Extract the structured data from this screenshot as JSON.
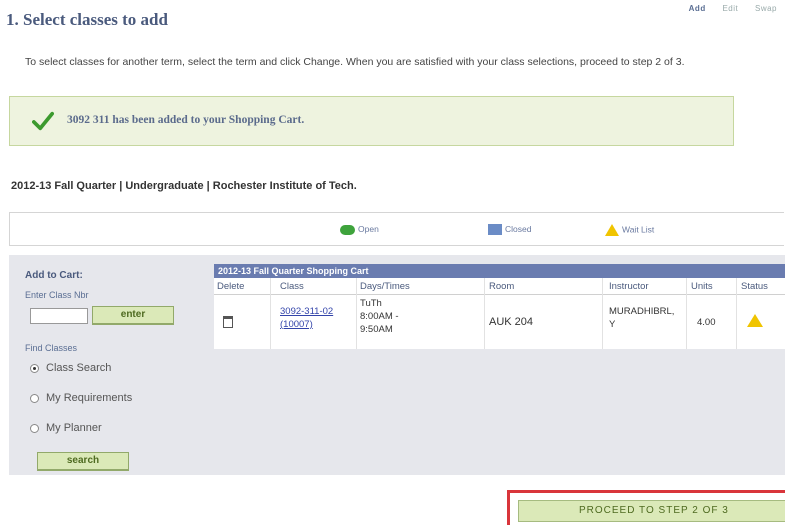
{
  "steps": [
    "Add",
    "Edit",
    "Swap"
  ],
  "page_title": "1.  Select classes to add",
  "instructions": "To select classes for another term, select the term and click Change.  When you are satisfied with your class selections, proceed to step 2 of 3.",
  "message": "3092 311 has been added to your Shopping Cart.",
  "term": "2012-13 Fall Quarter | Undergraduate | Rochester Institute of Tech.",
  "legend": {
    "open": "Open",
    "closed": "Closed",
    "wait": "Wait List"
  },
  "left": {
    "add_to_cart": "Add to Cart:",
    "enter_class_nbr": "Enter Class Nbr",
    "enter_button": "enter",
    "find_classes": "Find Classes",
    "options": [
      "Class Search",
      "My Requirements",
      "My Planner"
    ],
    "search_button": "search"
  },
  "cart": {
    "header": "2012-13 Fall Quarter Shopping Cart",
    "columns": [
      "Delete",
      "Class",
      "Days/Times",
      "Room",
      "Instructor",
      "Units",
      "Status"
    ],
    "row": {
      "class_l1": "3092-311-02",
      "class_l2": "(10007)",
      "time_l1": "TuTh",
      "time_l2": "8:00AM -",
      "time_l3": "9:50AM",
      "room": "AUK 204",
      "instructor_l1": "MURADHIBRL,",
      "instructor_l2": "Y",
      "units": "4.00"
    }
  },
  "proceed_button": "PROCEED TO STEP 2 OF 3",
  "colors": {
    "accent": "#4a5a7d",
    "open": "#3ea33c",
    "closed": "#6b8cc6",
    "wait": "#f0c400",
    "highlight": "#d9353b"
  }
}
